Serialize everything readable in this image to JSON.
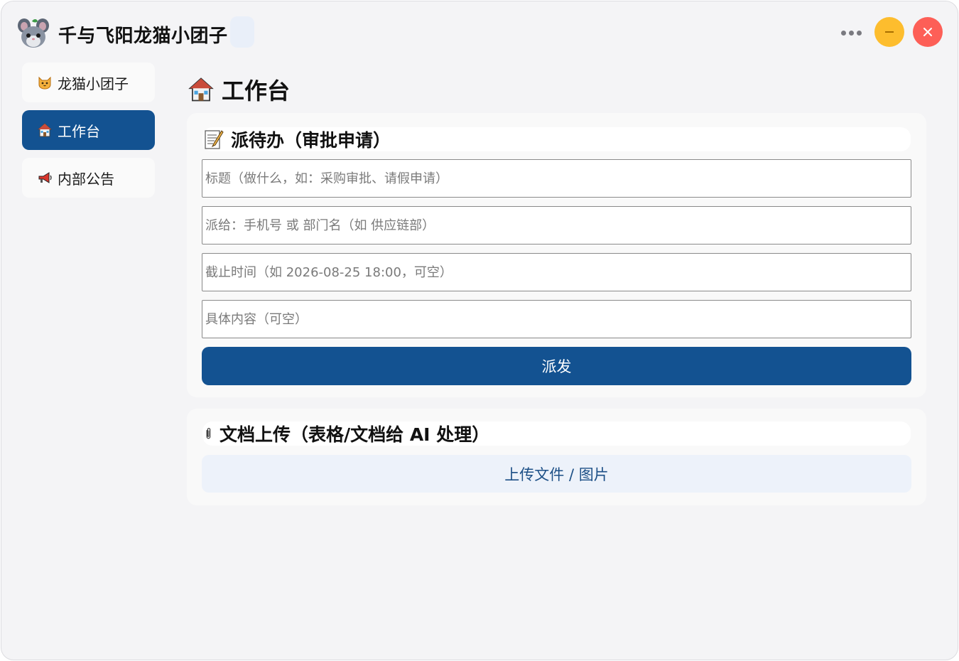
{
  "app": {
    "title": "千与飞阳龙猫小团子",
    "logo_icon": "chinchilla-avatar-icon"
  },
  "window_controls": {
    "more_icon": "more-dots-icon",
    "minimize_color": "#fdbd2e",
    "close_color": "#fd5f57"
  },
  "sidebar": {
    "items": [
      {
        "label": "龙猫小团子",
        "icon": "cat-face-icon",
        "active": false
      },
      {
        "label": "工作台",
        "icon": "house-icon",
        "active": true
      },
      {
        "label": "内部公告",
        "icon": "megaphone-icon",
        "active": false
      }
    ]
  },
  "main": {
    "title": "工作台",
    "title_icon": "house-icon",
    "task_card": {
      "title": "派待办（审批申请）",
      "icon": "memo-icon",
      "fields": {
        "title_placeholder": "标题（做什么，如：采购审批、请假申请）",
        "assignee_placeholder": "派给：手机号 或 部门名（如 供应链部）",
        "deadline_placeholder": "截止时间（如 2026-08-25 18:00，可空）",
        "content_placeholder": "具体内容（可空）"
      },
      "submit_label": "派发"
    },
    "upload_card": {
      "title": "文档上传（表格/文档给 AI 处理）",
      "icon": "paperclip-icon",
      "button_label": "上传文件 / 图片"
    }
  },
  "colors": {
    "accent": "#135291",
    "background": "#f4f4f6",
    "card": "#f9f9f9",
    "upload_button_bg": "#edf2fa"
  }
}
